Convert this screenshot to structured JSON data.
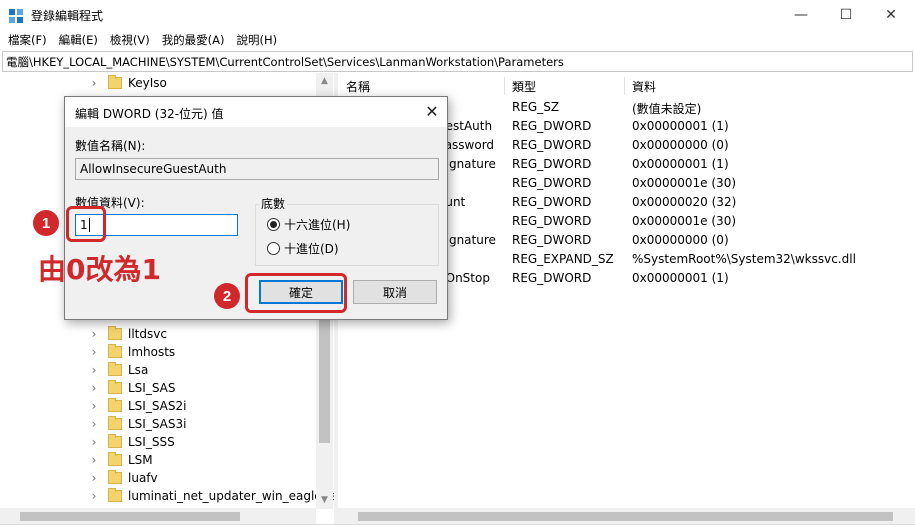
{
  "window": {
    "title": "登錄編輯程式",
    "minimize_glyph": "—",
    "maximize_glyph": "☐",
    "close_glyph": "✕"
  },
  "menu": [
    "檔案(F)",
    "編輯(E)",
    "檢視(V)",
    "我的最愛(A)",
    "說明(H)"
  ],
  "address": "電腦\\HKEY_LOCAL_MACHINE\\SYSTEM\\CurrentControlSet\\Services\\LanmanWorkstation\\Parameters",
  "tree": {
    "top_item": "KeyIso",
    "items": [
      "lltdsvc",
      "lmhosts",
      "Lsa",
      "LSI_SAS",
      "LSI_SAS2i",
      "LSI_SAS3i",
      "LSI_SSS",
      "LSM",
      "luafv",
      "luminati_net_updater_win_eaglege"
    ]
  },
  "values": {
    "columns": [
      "名稱",
      "類型",
      "資料"
    ],
    "rows": [
      {
        "name": "",
        "type": "REG_SZ",
        "data": "(數值未設定)"
      },
      {
        "name": "uestAuth",
        "type": "REG_DWORD",
        "data": "0x00000001 (1)"
      },
      {
        "name": "Password",
        "type": "REG_DWORD",
        "data": "0x00000000 (0)"
      },
      {
        "name": "Signature",
        "type": "REG_DWORD",
        "data": "0x00000001 (1)"
      },
      {
        "name": "",
        "type": "REG_DWORD",
        "data": "0x0000001e (30)"
      },
      {
        "name": "ount",
        "type": "REG_DWORD",
        "data": "0x00000020 (32)"
      },
      {
        "name": "",
        "type": "REG_DWORD",
        "data": "0x0000001e (30)"
      },
      {
        "name": "Signature",
        "type": "REG_DWORD",
        "data": "0x00000000 (0)"
      },
      {
        "name": "",
        "type": "REG_EXPAND_SZ",
        "data": "%SystemRoot%\\System32\\wkssvc.dll"
      },
      {
        "name": "dOnStop",
        "type": "REG_DWORD",
        "data": "0x00000001 (1)"
      }
    ]
  },
  "dialog": {
    "title": "編輯 DWORD (32-位元) 值",
    "name_label": "數值名稱(N):",
    "name_value": "AllowInsecureGuestAuth",
    "data_label": "數值資料(V):",
    "data_value": "1",
    "base_label": "底數",
    "radio_hex": "十六進位(H)",
    "radio_dec": "十進位(D)",
    "ok_label": "確定",
    "cancel_label": "取消"
  },
  "annotations": {
    "step1": "1",
    "step2": "2",
    "note": "由0改為1",
    "color": "#d0282b"
  }
}
